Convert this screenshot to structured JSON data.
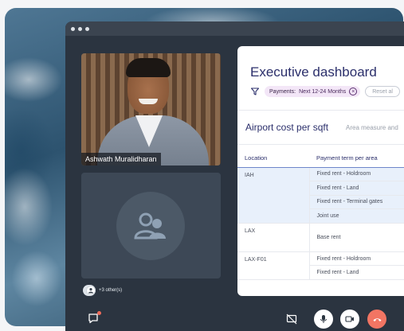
{
  "window": {
    "controls": [
      "close",
      "minimize",
      "maximize"
    ]
  },
  "participants": {
    "main": {
      "name": "Ashwath Muralidharan"
    },
    "others_label": "+3 other(s)"
  },
  "controls": {
    "chat_icon": "chat-bubble-icon",
    "screen_share_icon": "screen-share-off-icon",
    "mic_icon": "microphone-icon",
    "camera_icon": "video-camera-icon",
    "end_call_icon": "phone-hangup-icon",
    "end_call_color": "#f27563"
  },
  "dashboard": {
    "title": "Executive dashboard",
    "filter_chip": {
      "key": "Payments:",
      "value": "Next 12-24 Months"
    },
    "reset_label": "Reset al",
    "section_title": "Airport cost per sqft",
    "section_subtitle": "Area measure and",
    "columns": [
      "Location",
      "Payment term per area"
    ],
    "rows": [
      {
        "location": "IAH",
        "terms": [
          "Fixed rent - Holdroom",
          "Fixed rent - Land",
          "Fixed rent - Terminal gates",
          "Joint use"
        ],
        "highlighted": true
      },
      {
        "location": "LAX",
        "terms": [
          "Base rent"
        ],
        "highlighted": false
      },
      {
        "location": "LAX-F01",
        "terms": [
          "Fixed rent - Holdroom",
          "Fixed rent - Land"
        ],
        "highlighted": false
      }
    ]
  }
}
